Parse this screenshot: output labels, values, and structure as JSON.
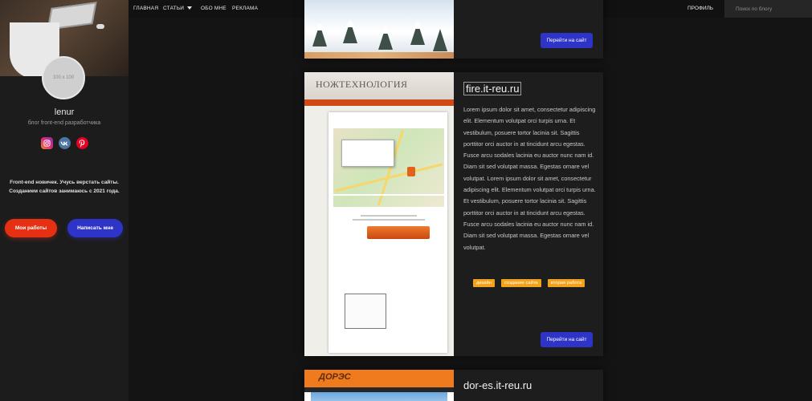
{
  "nav": {
    "items": [
      "ГЛАВНАЯ",
      "СТАТЬИ",
      "ОБО МНЕ",
      "РЕКЛАМА"
    ],
    "profile": "ПРОФИЛЬ",
    "search_placeholder": "Поиск по блогу"
  },
  "sidebar": {
    "avatar_placeholder": "100 x 100",
    "name": "lenur",
    "subtitle": "блог front-end разработчика",
    "socials": [
      "instagram-icon",
      "vk-icon",
      "pinterest-icon"
    ],
    "about_line1": "Front-end новичек. Учусь верстать сайты.",
    "about_line2": "Созданием сайтов занимаюсь с 2021 года.",
    "btn_works": "Мои работы",
    "btn_write": "Написать мне"
  },
  "cards": [
    {
      "button": "Перейти на сайт"
    },
    {
      "title": "fire.it-reu.ru",
      "text": "Lorem ipsum dolor sit amet, consectetur adipiscing elit. Elementum volutpat orci turpis urna. Et vestibulum, posuere tortor lacinia sit. Sagittis porttitor orci auctor in at tincidunt arcu egestas. Fusce arcu sodales lacinia eu auctor nunc nam id. Diam sit sed volutpat massa. Egestas ornare vel volutpat. Lorem ipsum dolor sit amet, consectetur adipiscing elit. Elementum volutpat orci turpis urna. Et vestibulum, posuere tortor lacinia sit. Sagittis porttitor orci auctor in at tincidunt arcu egestas. Fusce arcu sodales lacinia eu auctor nunc nam id. Diam sit sed volutpat massa. Egestas ornare vel volutpat.",
      "tags": [
        "дизайн",
        "создание сайта",
        "вторая работа"
      ],
      "button": "Перейти на сайт",
      "thumb_logo": "НОЖТЕХНОЛОГИЯ"
    },
    {
      "title": "dor-es.it-reu.ru",
      "thumb_logo": "ДОРЭС"
    }
  ],
  "colors": {
    "background": "#141414",
    "card": "#1d1d1d",
    "accent_blue": "#2f34c9",
    "accent_red": "#e53014",
    "tag_orange": "#f3a21b"
  }
}
